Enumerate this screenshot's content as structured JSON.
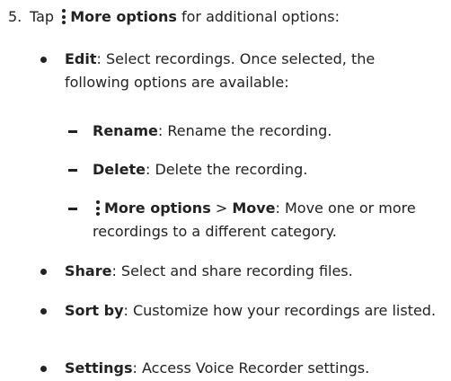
{
  "step": {
    "number": "5.",
    "prefix": "Tap",
    "label": "More options",
    "suffix": "for additional options:"
  },
  "bullets": [
    {
      "term": "Edit",
      "text": ": Select recordings. Once selected, the following options are available:"
    },
    {
      "term": "Share",
      "text": ": Select and share recording files."
    },
    {
      "term": "Sort by",
      "text": ": Customize how your recordings are listed."
    },
    {
      "term": "Settings",
      "text": ": Access Voice Recorder settings."
    }
  ],
  "sub_items": [
    {
      "term": "Rename",
      "text": ": Rename the recording."
    },
    {
      "term": "Delete",
      "text": ": Delete the recording."
    },
    {
      "term": "More options",
      "separator": ">",
      "term2": "Move",
      "text": ": Move one or more recordings to a different category."
    }
  ],
  "icons": {
    "more_options": "more-options-vertical-icon"
  }
}
